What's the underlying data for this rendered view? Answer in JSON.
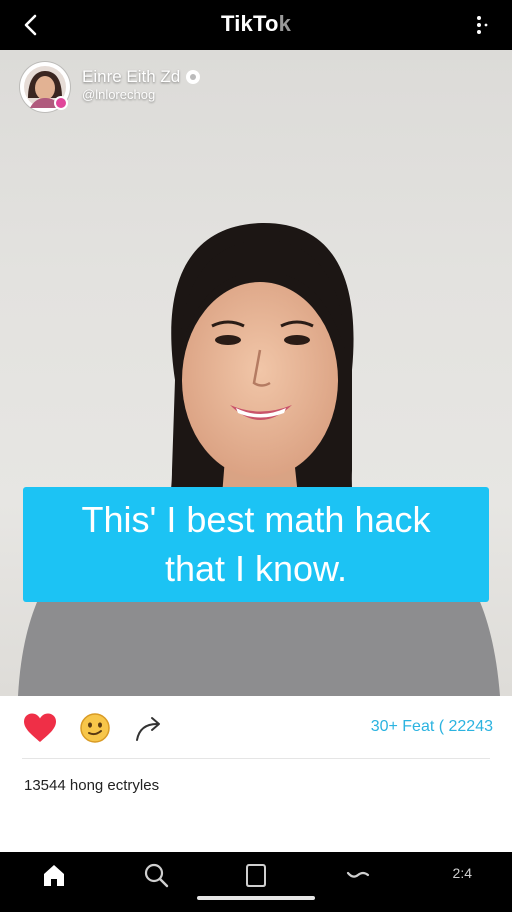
{
  "header": {
    "title_main": "TikTo",
    "title_tail": "k",
    "back_icon": "chevron-left-icon",
    "more_icon": "more-vertical-icon"
  },
  "creator": {
    "name": "Einre Eith Zd",
    "handle": "@lnlorechog",
    "avatar_icon": "profile-avatar",
    "verified_icon": "verified-badge-icon"
  },
  "caption": {
    "line1": "This' I best math hack",
    "line2": "that I know.",
    "color": "#1cc3f4"
  },
  "actions": {
    "like_icon": "heart-icon",
    "emoji_icon": "smiley-emoji-icon",
    "share_icon": "share-arrow-icon",
    "stats": "30+ Feat ( 22243",
    "like_color": "#ef2f47",
    "stats_color": "#2bb3e0"
  },
  "likes_text": "13544 hong ectryles",
  "bottom_nav": {
    "items": [
      {
        "icon": "home-icon"
      },
      {
        "icon": "search-icon"
      },
      {
        "icon": "square-icon"
      },
      {
        "icon": "wave-icon"
      }
    ],
    "time": "2:4"
  }
}
